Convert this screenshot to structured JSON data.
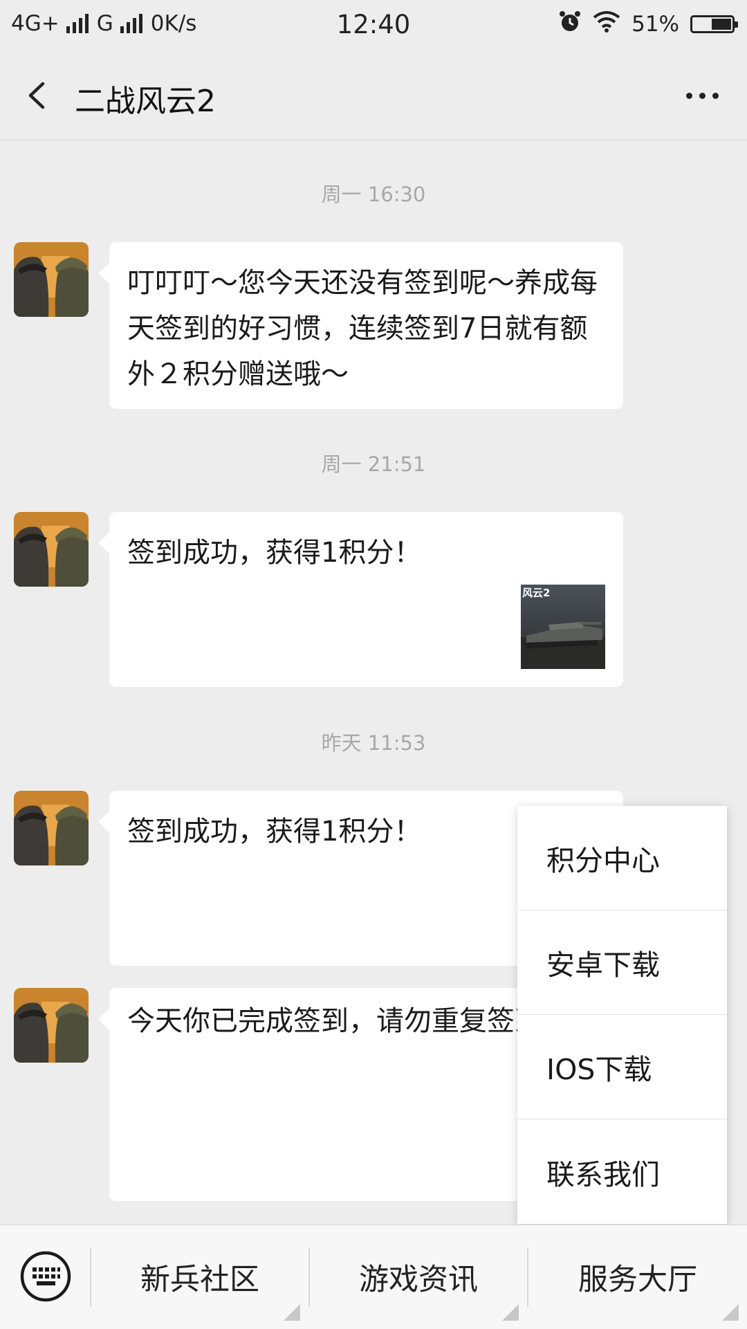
{
  "status_bar": {
    "network_1": "4G+",
    "network_2": "G",
    "speed": "0K/s",
    "time": "12:40",
    "battery": "51%",
    "battery_level": 0.51
  },
  "header": {
    "title": "二战风云2",
    "back_icon": "back-chevron-icon",
    "more_icon": "more-dots-icon"
  },
  "messages": [
    {
      "timestamp": "周一 16:30",
      "text": "叮叮叮～您今天还没有签到呢～养成每天签到的好习惯，连续签到7日就有额外２积分赠送哦～",
      "has_thumbnail": false
    },
    {
      "timestamp": "周一 21:51",
      "text": "签到成功，获得1积分！",
      "has_thumbnail": true,
      "thumbnail_label": "风云2"
    },
    {
      "timestamp": "昨天 11:53",
      "text": "签到成功，获得1积分！",
      "has_thumbnail": false
    },
    {
      "timestamp": "",
      "text": "今天你已完成签到，请勿重复签到！",
      "has_thumbnail": false
    }
  ],
  "popup_menu": {
    "items": [
      "积分中心",
      "安卓下载",
      "IOS下载",
      "联系我们"
    ]
  },
  "bottom_bar": {
    "keyboard_icon": "keyboard-icon",
    "menus": [
      "新兵社区",
      "游戏资讯",
      "服务大厅"
    ]
  },
  "colors": {
    "background": "#ededed",
    "bubble": "#ffffff",
    "timestamp": "#a8a8a8"
  }
}
